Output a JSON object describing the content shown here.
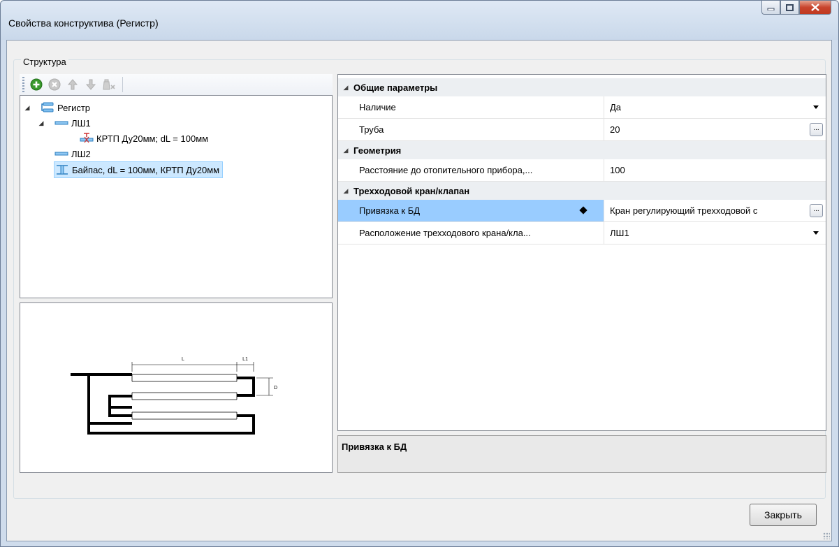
{
  "window": {
    "title": "Свойства конструктива (Регистр)",
    "buttons": {
      "minimize_icon": "minimize-icon",
      "maximize_icon": "maximize-icon",
      "close_icon": "close-icon"
    }
  },
  "structure": {
    "group_label": "Структура",
    "toolbar": {
      "buttons": [
        {
          "icon": "add-icon",
          "enabled": true
        },
        {
          "icon": "delete-icon",
          "enabled": false
        },
        {
          "icon": "arrow-up-icon",
          "enabled": false
        },
        {
          "icon": "arrow-down-icon",
          "enabled": false
        },
        {
          "icon": "clear-icon",
          "enabled": false
        }
      ]
    },
    "tree": [
      {
        "label": "Регистр",
        "icon": "register-icon",
        "expanded": true
      },
      {
        "label": "ЛШ1",
        "icon": "pipe-icon",
        "expanded": true
      },
      {
        "label": "КРТП Ду20мм; dL = 100мм",
        "icon": "valve-icon"
      },
      {
        "label": "ЛШ2",
        "icon": "pipe-icon"
      },
      {
        "label": "Байпас, dL = 100мм, КРТП Ду20мм",
        "icon": "bypass-icon",
        "selected": true
      }
    ],
    "preview": {
      "dim_l": "L",
      "dim_l1": "L1",
      "dim_d": "D"
    }
  },
  "properties": {
    "categories": [
      {
        "label": "Общие параметры",
        "rows": [
          {
            "name": "Наличие",
            "value": "Да",
            "editor": "dropdown"
          },
          {
            "name": "Труба",
            "value": "20",
            "editor": "ellipsis"
          }
        ]
      },
      {
        "label": "Геометрия",
        "rows": [
          {
            "name": "Расстояние до отопительного прибора,...",
            "value": "100",
            "editor": "none"
          }
        ]
      },
      {
        "label": "Трехходовой кран/клапан",
        "rows": [
          {
            "name": "Привязка к БД",
            "value": "Кран регулирующий трехходовой с",
            "editor": "ellipsis",
            "selected": true
          },
          {
            "name": "Расположение трехходового крана/кла...",
            "value": "ЛШ1",
            "editor": "dropdown"
          }
        ]
      }
    ],
    "ellipsis_label": "...",
    "description_title": "Привязка к БД"
  },
  "footer": {
    "close_label": "Закрыть"
  },
  "colors": {
    "selection": "#99ccff",
    "tree_selection": "#cce8ff",
    "category_bg": "#eceff2"
  }
}
